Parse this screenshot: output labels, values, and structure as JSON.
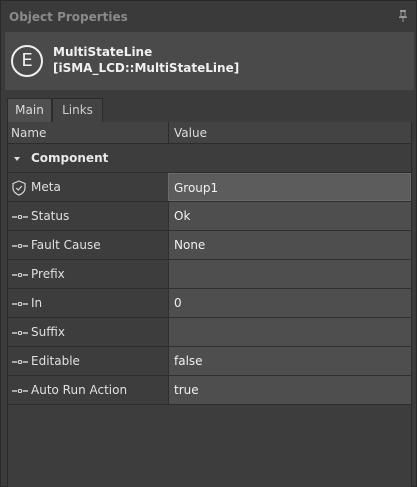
{
  "panel": {
    "title": "Object Properties"
  },
  "object": {
    "icon_letter": "E",
    "name": "MultiStateLine",
    "type": "[iSMA_LCD::MultiStateLine]"
  },
  "tabs": [
    {
      "label": "Main",
      "active": true
    },
    {
      "label": "Links",
      "active": false
    }
  ],
  "grid": {
    "col_name": "Name",
    "col_value": "Value",
    "group_label": "Component",
    "rows": [
      {
        "name": "Meta",
        "value": "Group1",
        "icon": "shield-icon",
        "editable": true
      },
      {
        "name": "Status",
        "value": "Ok",
        "icon": "property-slot-icon",
        "editable": false
      },
      {
        "name": "Fault Cause",
        "value": "None",
        "icon": "property-slot-icon",
        "editable": false
      },
      {
        "name": "Prefix",
        "value": "",
        "icon": "property-slot-icon",
        "editable": false
      },
      {
        "name": "In",
        "value": "0",
        "icon": "property-slot-icon",
        "editable": false
      },
      {
        "name": "Suffix",
        "value": "",
        "icon": "property-slot-icon",
        "editable": false
      },
      {
        "name": "Editable",
        "value": "false",
        "icon": "property-slot-icon",
        "editable": false
      },
      {
        "name": "Auto Run Action",
        "value": "true",
        "icon": "property-slot-icon",
        "editable": false
      }
    ]
  }
}
